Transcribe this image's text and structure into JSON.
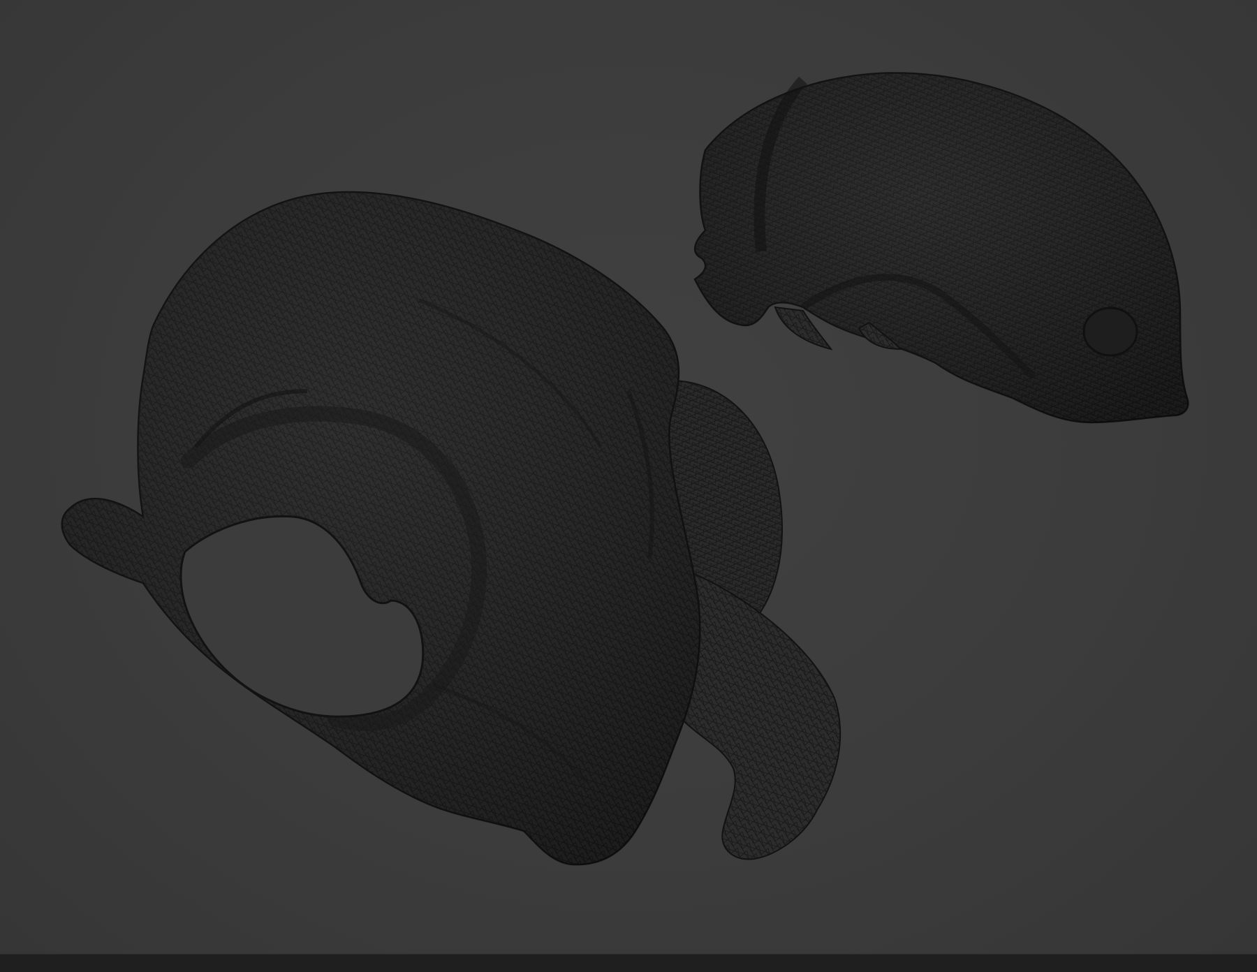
{
  "viewport": {
    "background_color": "#3c3c3c",
    "mesh_fill_color": "#2b2b2b",
    "wire_color": "#141414",
    "shading": "wireframe-overlay"
  },
  "status_bar": {
    "background_color": "#1f1f1f"
  }
}
